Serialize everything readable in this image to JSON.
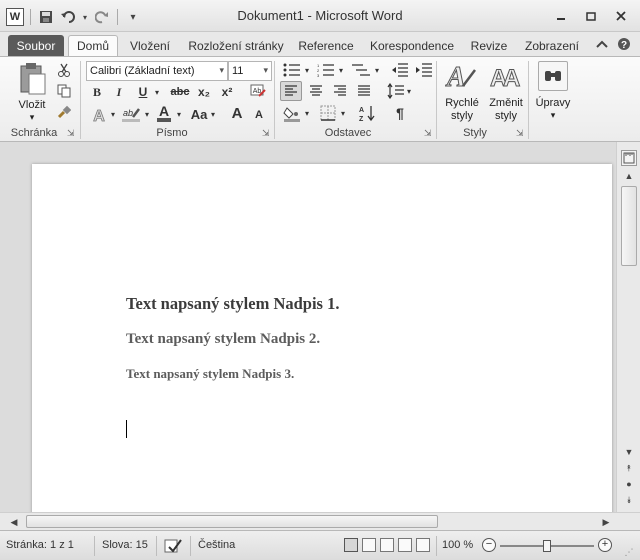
{
  "window": {
    "title": "Dokument1 - Microsoft Word",
    "controls": {
      "minimize": "▭",
      "restore": "❐",
      "close": "✕"
    }
  },
  "qat": {
    "logo_letter": "W",
    "icons": [
      "word-logo-icon",
      "save-icon",
      "undo-icon",
      "redo-icon",
      "customize-qat-icon"
    ]
  },
  "tabs": [
    "Soubor",
    "Domů",
    "Vložení",
    "Rozložení stránky",
    "Reference",
    "Korespondence",
    "Revize",
    "Zobrazení"
  ],
  "active_tab": "Domů",
  "ribbon": {
    "clipboard": {
      "label": "Schránka",
      "paste_label": "Vložit"
    },
    "font": {
      "label": "Písmo",
      "font_name": "Calibri (Základní text)",
      "font_size": "11",
      "bold": "B",
      "italic": "I",
      "underline": "U",
      "strikethrough": "abc",
      "subscript": "x₂",
      "superscript": "x²",
      "font_color": "A",
      "change_case": "Aa",
      "grow": "A",
      "shrink": "A"
    },
    "paragraph": {
      "label": "Odstavec",
      "show_marks": "¶"
    },
    "styles": {
      "label": "Styly",
      "quick_styles": "Rychlé styly",
      "change_styles": "Změnit styly"
    },
    "editing": {
      "label": "Úpravy"
    }
  },
  "document": {
    "h1": "Text napsaný stylem Nadpis 1.",
    "h2": "Text napsaný stylem Nadpis 2.",
    "h3": "Text napsaný stylem Nadpis 3."
  },
  "status": {
    "page": "Stránka: 1 z 1",
    "words": "Slova: 15",
    "language": "Čeština",
    "zoom": "100 %",
    "zoom_percent": 100
  },
  "colors": {
    "file_tab": "#5a5a5a",
    "heading1": "#3b3b3b",
    "heading2": "#5c5c5c"
  }
}
